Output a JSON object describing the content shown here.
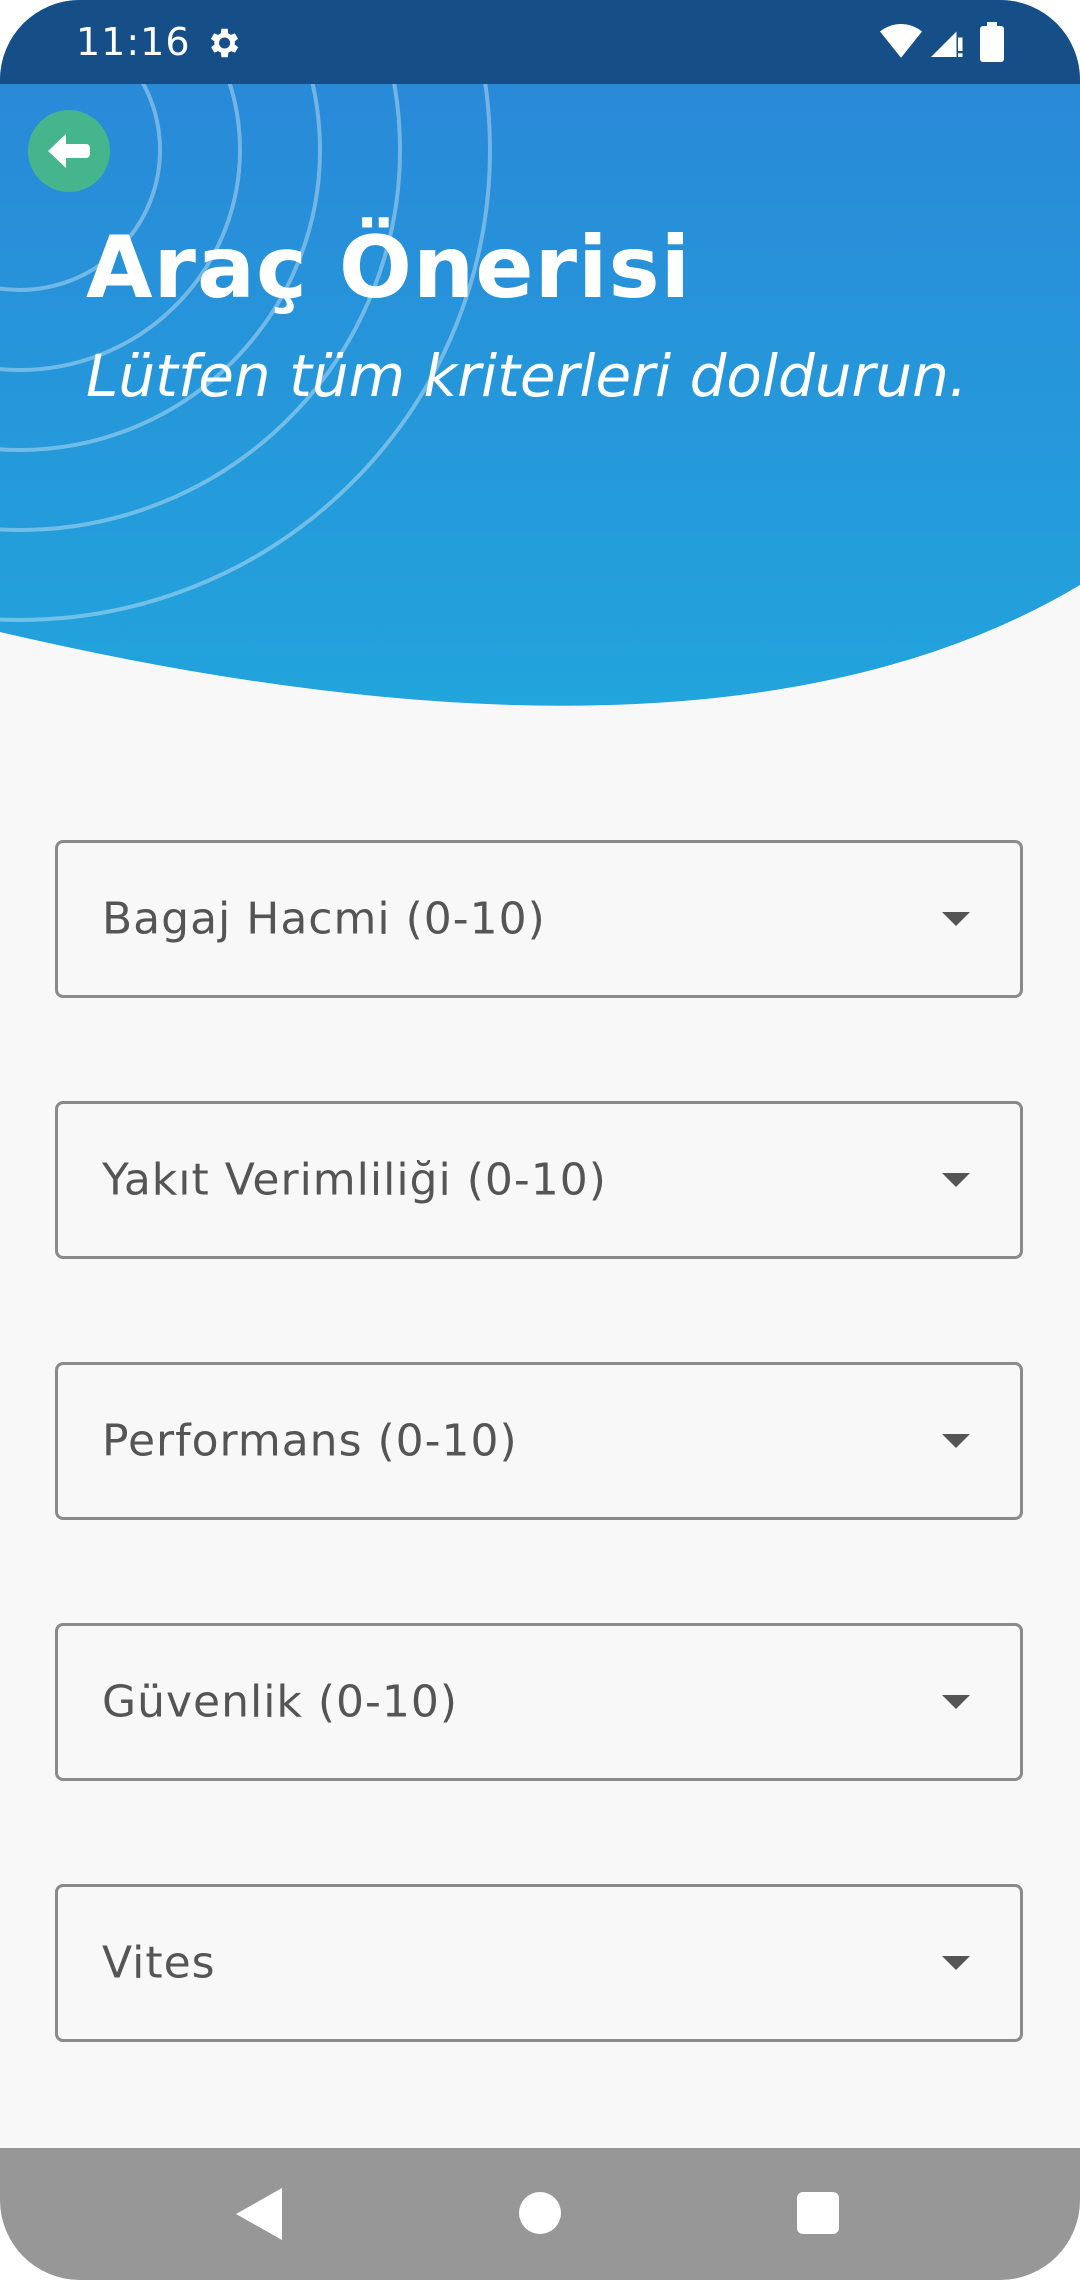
{
  "status_bar": {
    "time": "11:16",
    "icons": [
      "gear-icon",
      "wifi-icon",
      "signal-icon",
      "battery-icon"
    ]
  },
  "header": {
    "title": "Araç Önerisi",
    "subtitle": "Lütfen tüm kriterleri doldurun.",
    "back_icon": "arrow-left-icon",
    "colors": {
      "gradient_top": "#2a86d8",
      "gradient_bottom": "#22a4dc",
      "back_button": "#44b58d"
    }
  },
  "form": {
    "dropdowns": [
      {
        "label": "Bagaj Hacmi (0-10)"
      },
      {
        "label": "Yakıt Verimliliği (0-10)"
      },
      {
        "label": "Performans (0-10)"
      },
      {
        "label": "Güvenlik (0-10)"
      },
      {
        "label": "Vites"
      }
    ]
  },
  "nav_bar": {
    "icons": [
      "nav-back-icon",
      "nav-home-icon",
      "nav-recents-icon"
    ]
  }
}
